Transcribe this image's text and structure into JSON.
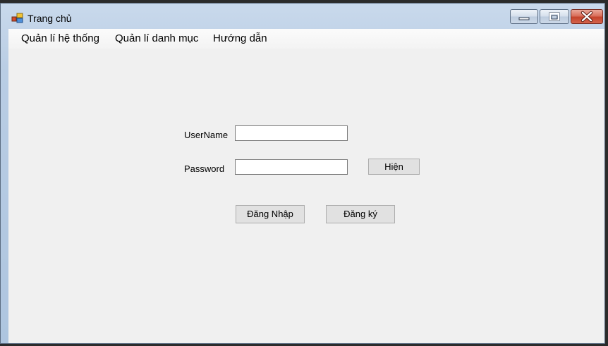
{
  "window": {
    "title": "Trang chủ",
    "icon": "app-window-icon",
    "controls": [
      "minimize-icon",
      "maximize-icon",
      "close-icon"
    ]
  },
  "menu": {
    "items": [
      {
        "label": "Quản lí hệ thống"
      },
      {
        "label": "Quản lí danh mục"
      },
      {
        "label": "Hướng dẫn"
      }
    ]
  },
  "login": {
    "username_label": "UserName",
    "username_value": "",
    "password_label": "Password",
    "password_value": "",
    "show_button": "Hiện",
    "login_button": "Đăng Nhập",
    "register_button": "Đăng ký"
  },
  "colors": {
    "client_bg": "#f0f0f0",
    "close_button": "#c4432b",
    "button_bg": "#e1e1e1"
  }
}
